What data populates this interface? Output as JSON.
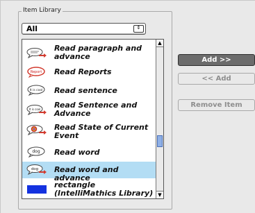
{
  "group": {
    "title": "Item Library"
  },
  "filter": {
    "selected": "All",
    "arrow": "⇕"
  },
  "list": {
    "items": [
      {
        "label": "Read paragraph and advance",
        "icon": "speech-bubble-arrow-icon",
        "selected": false
      },
      {
        "label": "Read Reports",
        "icon": "report-bubble-icon",
        "selected": false
      },
      {
        "label": "Read sentence",
        "icon": "speech-bubble-icon",
        "selected": false
      },
      {
        "label": "Read Sentence and Advance",
        "icon": "speech-bubble-arrow-icon",
        "selected": false
      },
      {
        "label": "Read State of Current Event",
        "icon": "event-bubble-arrow-icon",
        "selected": false
      },
      {
        "label": "Read word",
        "icon": "word-bubble-icon",
        "selected": false
      },
      {
        "label": "Read word and advance",
        "icon": "word-bubble-arrow-icon",
        "selected": true
      },
      {
        "label": "rectangle (IntelliMathics Library)",
        "icon": "blue-rectangle-icon",
        "selected": false
      }
    ],
    "icon_text": {
      "report": "Report",
      "sentence": "It is cool",
      "word": "dog"
    },
    "scroll_up": "▲",
    "scroll_down": "▼"
  },
  "actions": {
    "add": "Add >>",
    "remove_back": "<< Add",
    "remove_item": "Remove Item"
  },
  "colors": {
    "selection": "#b3ddf4",
    "bubble_red": "#d23a2e",
    "rect_blue": "#1432e0"
  }
}
